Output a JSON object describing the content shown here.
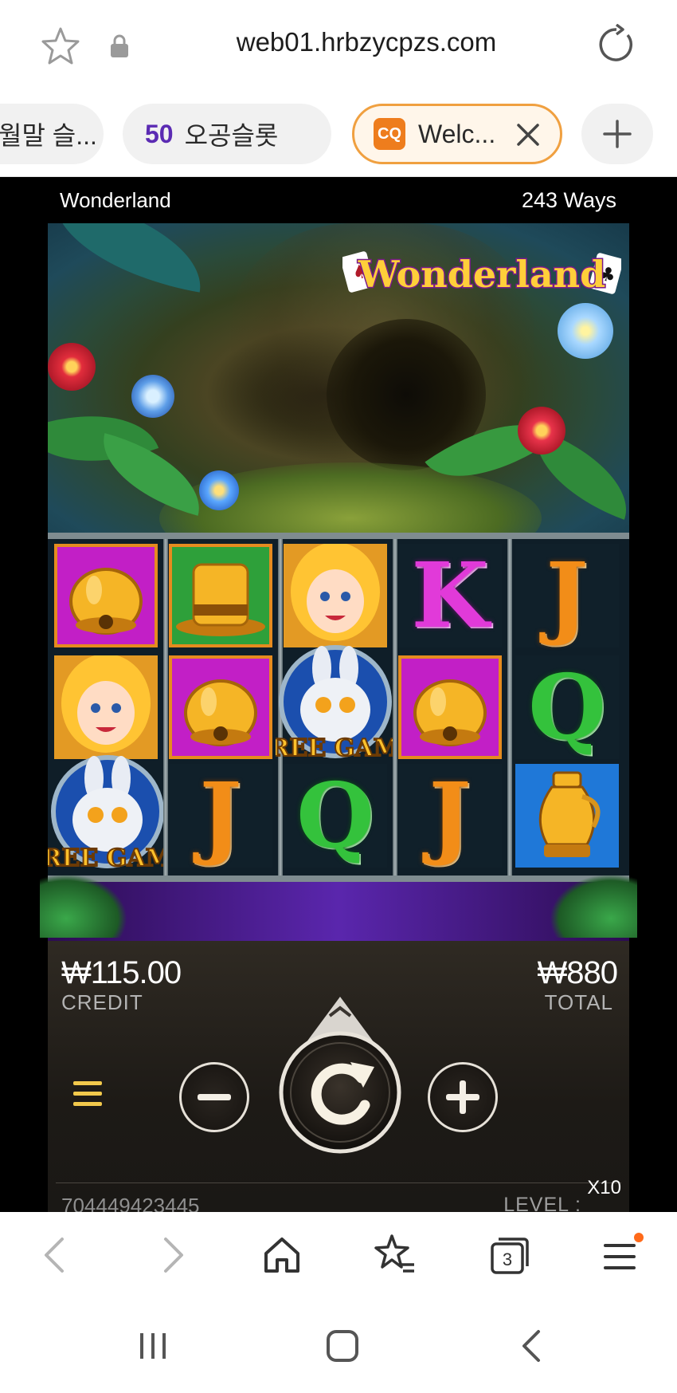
{
  "browser": {
    "url": "web01.hrbzycpzs.com",
    "tabs": [
      {
        "label": "월말 슬..."
      },
      {
        "badge": "50",
        "label": "오공슬롯"
      },
      {
        "favicon": "CQ",
        "label": "Welc...",
        "active": true
      }
    ],
    "tab_count": "3"
  },
  "game": {
    "title": "Wonderland",
    "ways": "243 Ways",
    "logo_text": "Wonderland",
    "symbols": {
      "reel1": [
        "bell",
        "alice",
        "rabbit-free-game"
      ],
      "reel2": [
        "top-hat",
        "bell",
        "J"
      ],
      "reel3": [
        "alice",
        "rabbit-free-game",
        "Q"
      ],
      "reel4": [
        "K",
        "bell",
        "J"
      ],
      "reel5": [
        "J",
        "Q",
        "golden-vase"
      ]
    },
    "letters": {
      "k": "K",
      "j": "J",
      "q": "Q"
    },
    "free_game_text": "FREE GAME",
    "credit_value": "₩115.00",
    "credit_label": "CREDIT",
    "total_value": "₩880",
    "total_label": "TOTAL",
    "round_id": "704449423445",
    "level_label": "LEVEL :",
    "multiplier": "X10"
  },
  "colors": {
    "accent_orange": "#f0a040",
    "tab_badge_purple": "#5b2bb3",
    "reel_bar_purple": "#5a26ad",
    "notification_dot": "#ff6a1a"
  }
}
